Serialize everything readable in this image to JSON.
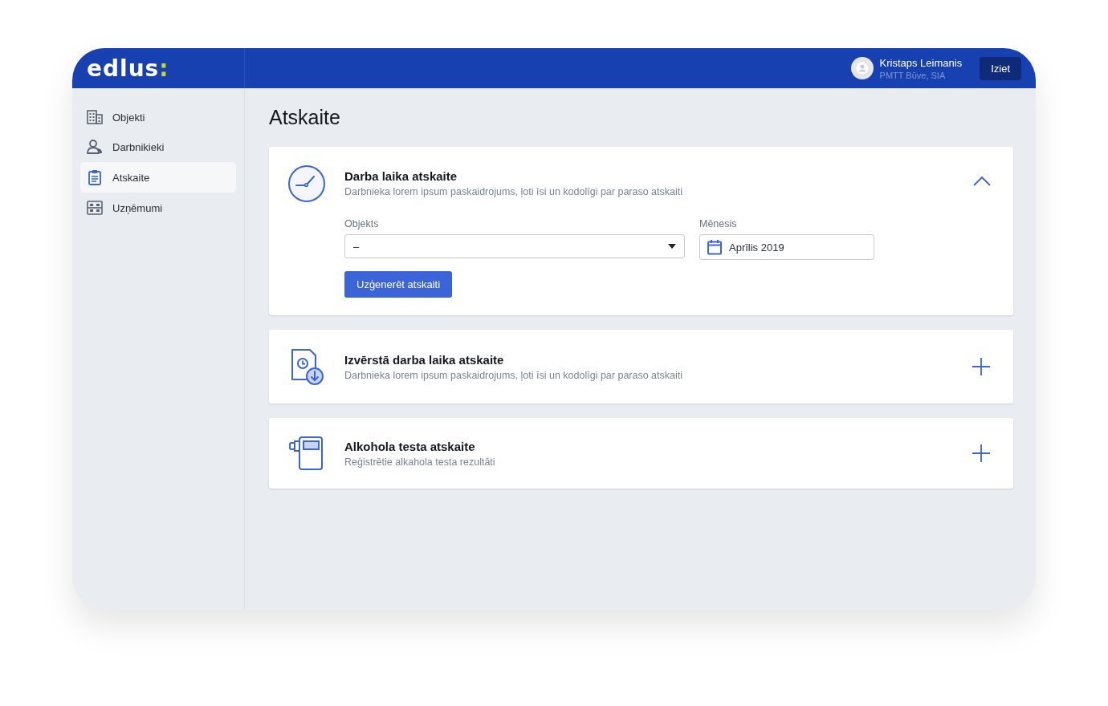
{
  "logo": {
    "text": "edlus",
    "mark": ":"
  },
  "user": {
    "name": "Kristaps Leimanis",
    "company": "PMTT Būve, SIA"
  },
  "logout_button": "Iziet",
  "sidebar": {
    "items": [
      {
        "label": "Objekti",
        "kind": "building",
        "selected": false
      },
      {
        "label": "Darbnikieki",
        "kind": "people",
        "selected": false
      },
      {
        "label": "Atskaite",
        "kind": "clipboard",
        "selected": true
      },
      {
        "label": "Uzņēmumi",
        "kind": "company",
        "selected": false
      }
    ]
  },
  "page_title": "Atskaite",
  "reports": [
    {
      "kind": "clock",
      "title": "Darba laika atskaite",
      "description": "Darbnieka lorem ipsum paskaidrojums, ļoti īsi un kodolīgi par paraso atskaiti",
      "expanded": true,
      "form": {
        "object_label": "Objekts",
        "object_value": "–",
        "month_label": "Mēnesis",
        "month_value": "Aprīlis 2019",
        "button": "Uzģenerēt atskaiti"
      }
    },
    {
      "kind": "document",
      "title": "Izvērstā darba laika atskaite",
      "description": "Darbnieka lorem ipsum paskaidrojums, ļoti īsi un kodolīgi par paraso atskaiti",
      "expanded": false
    },
    {
      "kind": "breathalyzer",
      "title": "Alkohola testa atskaite",
      "description": "Reģistrētie alkahola testa rezultāti",
      "expanded": false
    }
  ]
}
